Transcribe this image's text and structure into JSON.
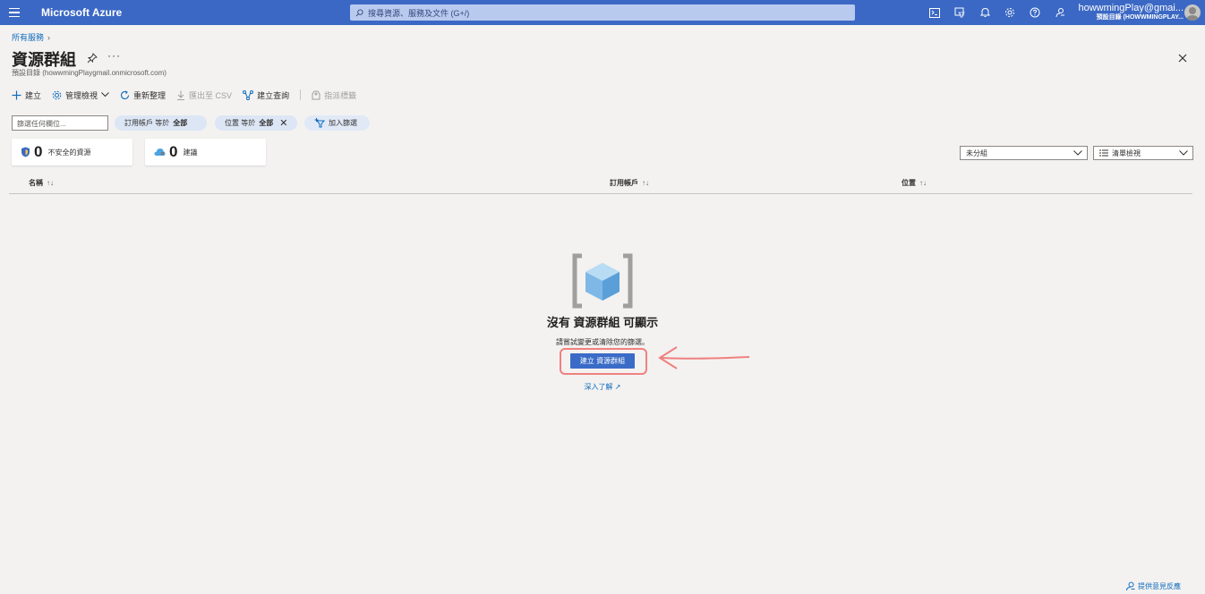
{
  "topbar": {
    "brand": "Microsoft Azure",
    "search_placeholder": "搜尋資源、服務及文件 (G+/)",
    "account_name": "howwmingPlay@gmai...",
    "account_directory": "預設目錄 (HOWWMINGPLAY..."
  },
  "header": {
    "breadcrumb": "所有服務",
    "title": "資源群組",
    "subtitle": "預設目錄 (howwmingPlaygmail.onmicrosoft.com)"
  },
  "commands": {
    "create": "建立",
    "manage_view": "管理檢視",
    "refresh": "重新整理",
    "export_csv": "匯出至 CSV",
    "open_query": "建立查詢",
    "assign_tags": "指派標籤"
  },
  "filters": {
    "search_placeholder": "篩選任何欄位...",
    "subscription_label": "訂用帳戶 等於",
    "subscription_value": "全部",
    "location_label": "位置 等於",
    "location_value": "全部",
    "add_filter": "加入篩選"
  },
  "cards": {
    "insecure_count": "0",
    "insecure_label": "不安全的資源",
    "recommend_count": "0",
    "recommend_label": "建議"
  },
  "dropdowns": {
    "grouping": "未分組",
    "view": "清單檢視"
  },
  "table": {
    "columns": [
      "名稱",
      "訂用帳戶",
      "位置"
    ]
  },
  "empty_state": {
    "title": "沒有 資源群組 可顯示",
    "description": "請嘗試變更或清除您的篩選。",
    "create_button": "建立 資源群組",
    "learn_more": "深入了解"
  },
  "footer": {
    "feedback": "提供意見反應"
  },
  "colors": {
    "topbar": "#3b68c4",
    "primary_button": "#3a6bc7",
    "annotation": "#f08080"
  }
}
